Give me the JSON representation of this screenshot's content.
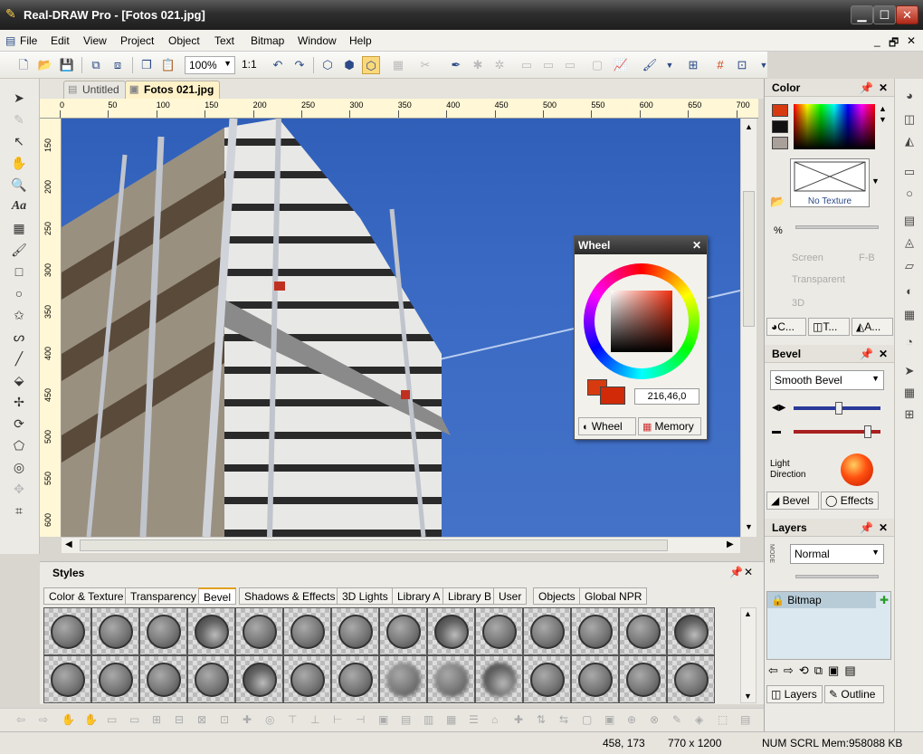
{
  "window": {
    "title": "Real-DRAW Pro - [Fotos 021.jpg]",
    "min": "▁",
    "max": "☐",
    "close": "✕",
    "inner_min": "_",
    "inner_restore": "🗗",
    "inner_close": "✕"
  },
  "menu": [
    "File",
    "Edit",
    "View",
    "Project",
    "Object",
    "Text",
    "Bitmap",
    "Window",
    "Help"
  ],
  "toolbar": {
    "zoom": "100%",
    "ratio": "1:1"
  },
  "doc_tabs": [
    {
      "label": "Untitled"
    },
    {
      "label": "Fotos 021.jpg"
    }
  ],
  "ruler_h": [
    "0",
    "50",
    "100",
    "150",
    "200",
    "250",
    "300",
    "350",
    "400",
    "450",
    "500",
    "550",
    "600",
    "650",
    "700"
  ],
  "ruler_v": [
    "150",
    "200",
    "250",
    "300",
    "350",
    "400",
    "450",
    "500",
    "550",
    "600"
  ],
  "wheel_panel": {
    "title": "Wheel",
    "value": "216,46,0",
    "tabs": [
      "Wheel",
      "Memory"
    ],
    "color": "#d83a10"
  },
  "color_panel": {
    "title": "Color",
    "texture": "No Texture",
    "percent": "%",
    "opt1": "Screen",
    "opt2": "F-B",
    "opt3": "Transparent",
    "opt4": "3D",
    "tabs": [
      "C...",
      "T...",
      "A..."
    ]
  },
  "bevel_panel": {
    "title": "Bevel",
    "type": "Smooth Bevel",
    "light_label": "Light Direction",
    "tabs": [
      "Bevel",
      "Effects"
    ]
  },
  "layers_panel": {
    "title": "Layers",
    "mode_label": "MODE",
    "mode": "Normal",
    "layer": "Bitmap",
    "tabs": [
      "Layers",
      "Outline"
    ]
  },
  "styles": {
    "title": "Styles",
    "tabs": [
      "Color & Texture",
      "Transparency",
      "Bevel",
      "Shadows & Effects",
      "3D Lights",
      "Library A",
      "Library B",
      "User",
      "Objects",
      "Global NPR"
    ],
    "active_tab": 2
  },
  "status": {
    "coords": "458, 173",
    "size": "770 x 1200",
    "num": "NUM",
    "scrl": "SCRL",
    "mem": "Mem:958088 KB"
  }
}
